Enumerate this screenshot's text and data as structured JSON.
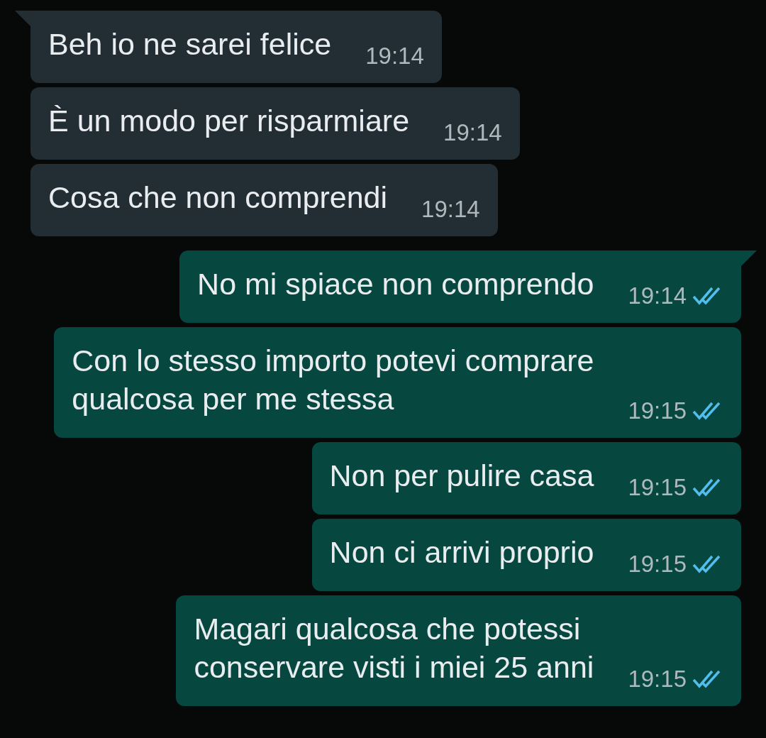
{
  "messages": [
    {
      "outgoing": false,
      "tail": true,
      "text": "Beh io ne sarei felice",
      "time": "19:14"
    },
    {
      "outgoing": false,
      "tail": false,
      "text": "È un modo per risparmiare",
      "time": "19:14"
    },
    {
      "outgoing": false,
      "tail": false,
      "text": "Cosa che non comprendi",
      "time": "19:14"
    },
    {
      "outgoing": true,
      "tail": true,
      "text": "No mi spiace non comprendo",
      "time": "19:14",
      "read": true
    },
    {
      "outgoing": true,
      "tail": false,
      "text": "Con lo stesso importo potevi comprare\nqualcosa per me stessa",
      "time": "19:15",
      "read": true
    },
    {
      "outgoing": true,
      "tail": false,
      "text": "Non per pulire casa",
      "time": "19:15",
      "read": true
    },
    {
      "outgoing": true,
      "tail": false,
      "text": "Non ci arrivi proprio",
      "time": "19:15",
      "read": true
    },
    {
      "outgoing": true,
      "tail": false,
      "text": "Magari qualcosa che potessi\nconservare visti i miei 25 anni",
      "time": "19:15",
      "read": true
    }
  ]
}
